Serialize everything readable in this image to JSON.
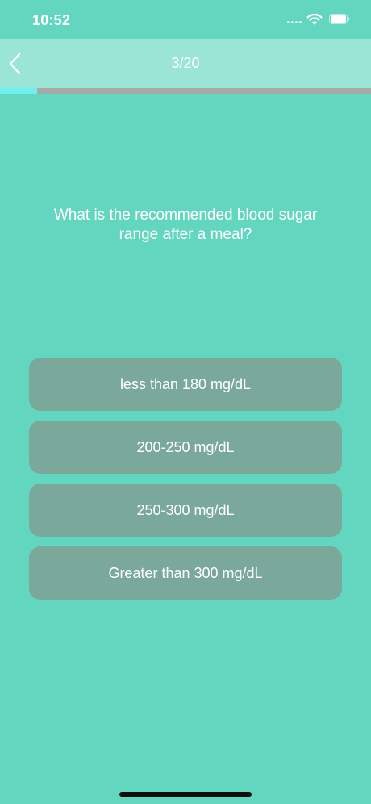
{
  "status_bar": {
    "time": "10:52"
  },
  "nav": {
    "title": "3/20",
    "back_icon": "chevron-left-icon"
  },
  "progress": {
    "fraction": 0.1
  },
  "question": {
    "text": "What is the recommended blood sugar range after a meal?"
  },
  "answers": [
    {
      "label": "less than 180 mg/dL"
    },
    {
      "label": "200-250 mg/dL"
    },
    {
      "label": "250-300 mg/dL"
    },
    {
      "label": "Greater than 300 mg/dL"
    }
  ],
  "colors": {
    "background": "#63d6c0",
    "nav_background": "#9be5d7",
    "answer_background": "#7aa89a",
    "progress_fill": "#6ff0ee",
    "progress_track": "#a3aaa7"
  }
}
